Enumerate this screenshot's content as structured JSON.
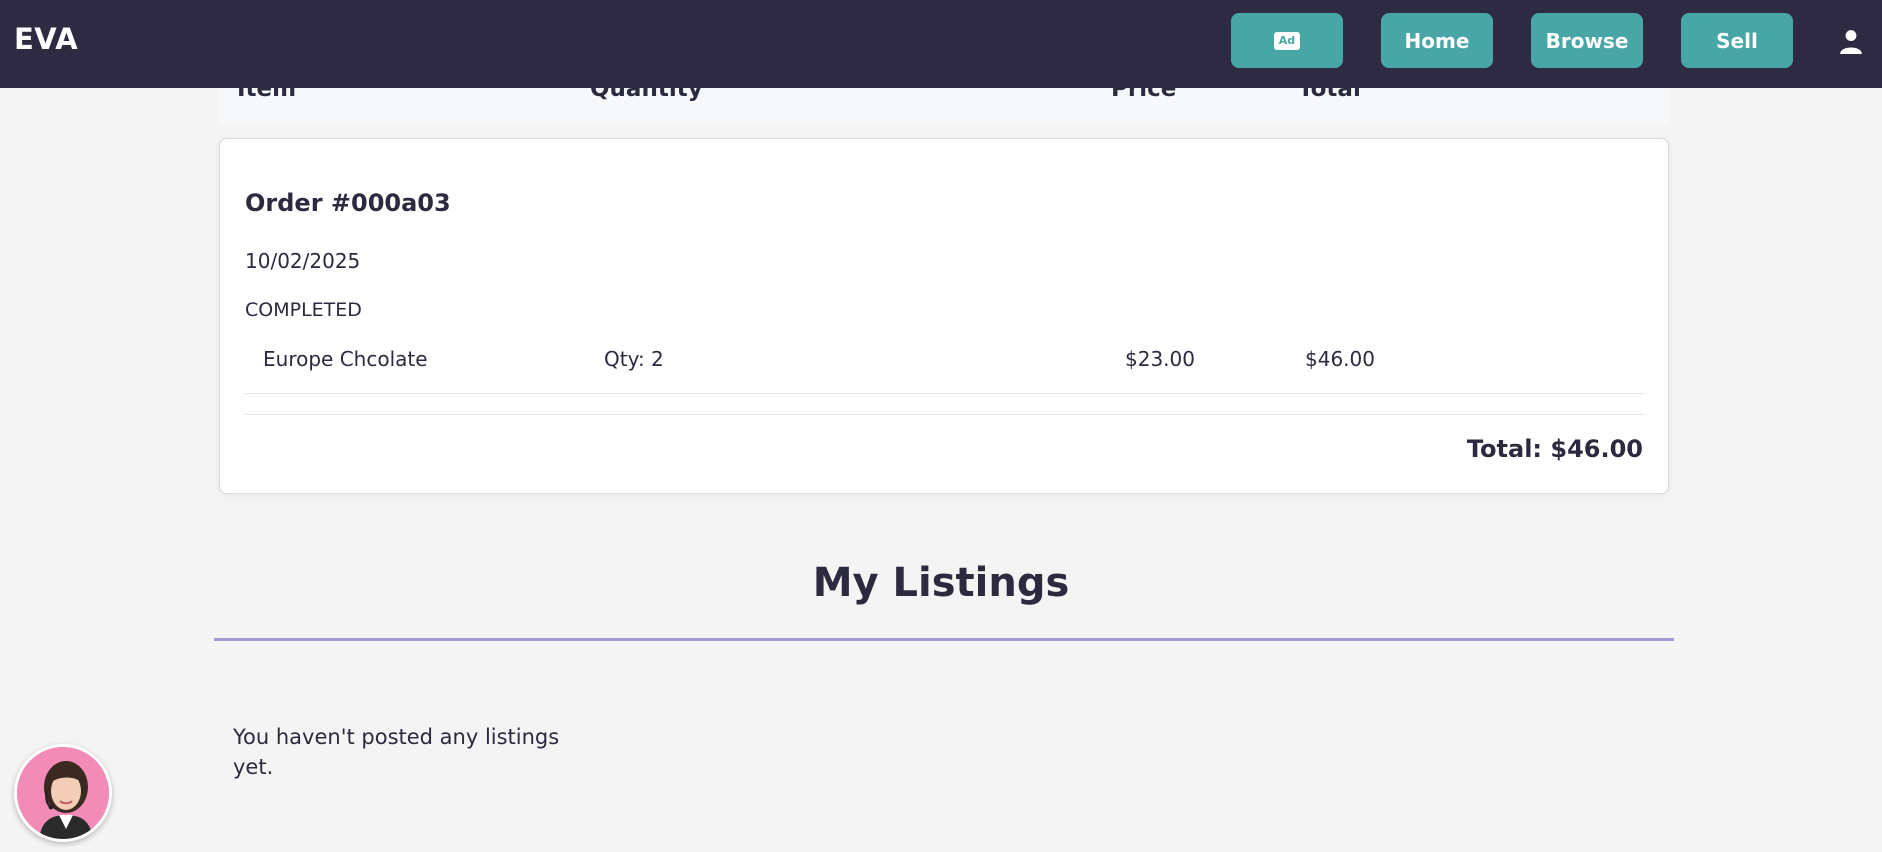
{
  "navbar": {
    "brand": "EVA",
    "ad_badge": "Ad",
    "home_label": "Home",
    "browse_label": "Browse",
    "sell_label": "Sell",
    "user_icon": "user-icon"
  },
  "order_table": {
    "headers": [
      "Item",
      "Quantity",
      "Price",
      "Total"
    ]
  },
  "order": {
    "title": "Order #000a03",
    "date": "10/02/2025",
    "status": "COMPLETED",
    "items": [
      {
        "name": "Europe Chcolate",
        "qty": "Qty: 2",
        "price": "$23.00",
        "total": "$46.00"
      }
    ],
    "total": "Total: $46.00"
  },
  "listings": {
    "title": "My Listings",
    "empty_message": "You haven't posted any listings yet."
  },
  "colors": {
    "navbar_bg": "#2d2a42",
    "accent": "#48a6a7",
    "divider": "#a59bd2",
    "page_bg": "#f4f4f4"
  }
}
